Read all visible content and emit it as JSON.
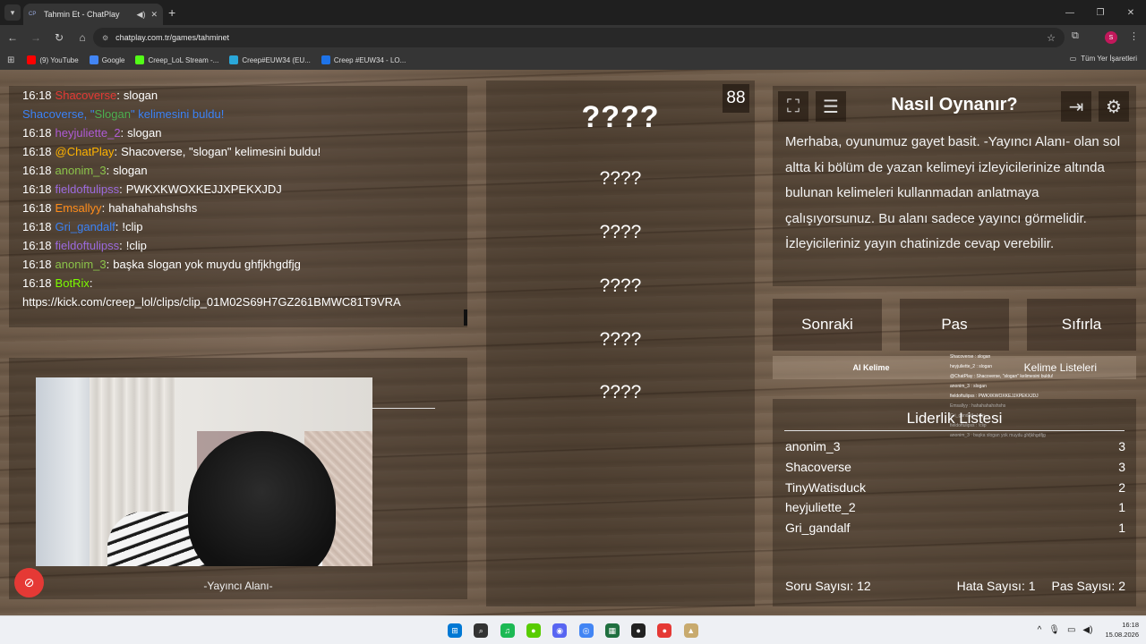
{
  "browser": {
    "tab_title": "Tahmin Et - ChatPlay",
    "tab_favicon": "CP",
    "url": "chatplay.com.tr/games/tahminet",
    "profile_initial": "S",
    "bookmarks": [
      {
        "label": "(9) YouTube",
        "icon": "youtube-icon",
        "color": "#ff0000"
      },
      {
        "label": "Google",
        "icon": "google-icon",
        "color": "#4285f4"
      },
      {
        "label": "Creep_LoL Stream -...",
        "icon": "kick-icon",
        "color": "#53fc18"
      },
      {
        "label": "Creep#EUW34 (EU...",
        "icon": "leagueofgraphs-icon",
        "color": "#2aa7d9"
      },
      {
        "label": "Creep #EUW34 - LO...",
        "icon": "porofessor-icon",
        "color": "#1e73e8"
      }
    ],
    "all_bookmarks_label": "Tüm Yer İşaretleri"
  },
  "chat": {
    "messages": [
      {
        "time": "16:18",
        "user": "Shacoverse",
        "user_color": "#e53935",
        "sep": ":",
        "text": "slogan"
      },
      {
        "system": true,
        "text_parts": [
          {
            "text": "Shacoverse, \"",
            "color": "#3b82f6"
          },
          {
            "text": "Slogan",
            "color": "#4caf50"
          },
          {
            "text": "\" kelimesini buldu!",
            "color": "#3b82f6"
          }
        ]
      },
      {
        "time": "16:18",
        "user": "heyjuliette_2",
        "user_color": "#b05cd6",
        "sep": ":",
        "text": "slogan"
      },
      {
        "time": "16:18",
        "user": "@ChatPlay",
        "user_color": "#ffb300",
        "sep": ":",
        "text": "Shacoverse, \"slogan\" kelimesini buldu!"
      },
      {
        "time": "16:18",
        "user": "anonim_3",
        "user_color": "#8bc34a",
        "sep": ":",
        "text": "slogan"
      },
      {
        "time": "16:18",
        "user": "fieldoftulipss",
        "user_color": "#9c6ade",
        "sep": ":",
        "text": "PWKXKWOXKEJJXPEKXJDJ"
      },
      {
        "time": "16:18",
        "user": "Emsallyy",
        "user_color": "#ff8c1a",
        "sep": ":",
        "text": "hahahahahshshs"
      },
      {
        "time": "16:18",
        "user": "Gri_gandalf",
        "user_color": "#3b82f6",
        "sep": ":",
        "text": "!clip"
      },
      {
        "time": "16:18",
        "user": "fieldoftulipss",
        "user_color": "#9c6ade",
        "sep": ":",
        "text": "!clip"
      },
      {
        "time": "16:18",
        "user": "anonim_3",
        "user_color": "#8bc34a",
        "sep": ":",
        "text": "başka slogan yok muydu ghfjkhgdfjg"
      },
      {
        "time": "16:18",
        "user": "BotRix",
        "user_color": "#7cfc00",
        "sep": ":",
        "text": ""
      },
      {
        "system": true,
        "text_parts": [
          {
            "text": "https://kick.com/creep_lol/clips/clip_01M02S69H7GZ261BMWC81T9VRA",
            "color": "#ffffff"
          }
        ]
      }
    ]
  },
  "streamer": {
    "label": "-Yayıncı Alanı-"
  },
  "words": {
    "timer": "88",
    "current": "????",
    "list": [
      "????",
      "????",
      "????",
      "????",
      "????"
    ]
  },
  "rules": {
    "title": "Nasıl Oynanır?",
    "text": "Merhaba, oyunumuz gayet basit. -Yayıncı Alanı- olan sol altta ki bölüm de yazan kelimeyi izleyicilerinize altında bulunan kelimeleri kullanmadan anlatmaya çalışıyorsunuz. Bu alanı sadece yayıncı görmelidir. İzleyicileriniz yayın chatinizde cevap verebilir."
  },
  "controls": {
    "next": "Sonraki",
    "pass": "Pas",
    "reset": "Sıfırla",
    "ai_word": "AI Kelime",
    "word_lists": "Kelime Listeleri"
  },
  "overlay_chat": [
    "Shacoverse : slogan",
    "heyjuliette_2 : slogan",
    "@ChatPlay : Shacoverse, \"slogan\" kelimesini buldu!",
    "anonim_3 : slogan",
    "fieldoftulipss : PWKXKWOXKEJJXPEKXJDJ",
    "Emsallyy : hahahahahshshs",
    "Gri_gandalf : !clip",
    "fieldoftulipss : !clip",
    "anonim_3 : başka slogan yok muydu ghfjkhgdfjg"
  ],
  "leaderboard": {
    "title": "Liderlik Listesi",
    "rows": [
      {
        "name": "anonim_3",
        "score": "3"
      },
      {
        "name": "Shacoverse",
        "score": "3"
      },
      {
        "name": "TinyWatisduck",
        "score": "2"
      },
      {
        "name": "heyjuliette_2",
        "score": "1"
      },
      {
        "name": "Gri_gandalf",
        "score": "1"
      }
    ],
    "questions": "Soru Sayısı: 12",
    "errors": "Hata Sayısı: 1",
    "passes": "Pas Sayısı: 2"
  },
  "taskbar": {
    "time": "16:18",
    "date": "15.08.2026",
    "apps": [
      {
        "name": "start-icon",
        "color": "#0078d4"
      },
      {
        "name": "search-icon",
        "color": "#333333"
      },
      {
        "name": "spotify-icon",
        "color": "#1db954"
      },
      {
        "name": "duolingo-icon",
        "color": "#58cc02"
      },
      {
        "name": "discord-icon",
        "color": "#5865f2"
      },
      {
        "name": "chrome-icon",
        "color": "#4285f4"
      },
      {
        "name": "app-icon",
        "color": "#1f6f3f"
      },
      {
        "name": "obs-icon",
        "color": "#222222"
      },
      {
        "name": "record-icon",
        "color": "#e53935"
      },
      {
        "name": "league-icon",
        "color": "#c8aa6e"
      }
    ]
  }
}
